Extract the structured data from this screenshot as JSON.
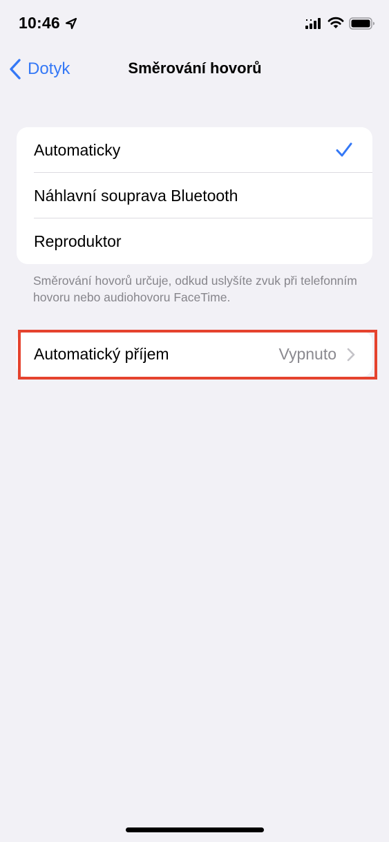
{
  "status_bar": {
    "time": "10:46"
  },
  "nav": {
    "back_label": "Dotyk",
    "title": "Směrování hovorů"
  },
  "routing_options": [
    {
      "label": "Automaticky",
      "selected": true
    },
    {
      "label": "Náhlavní souprava Bluetooth",
      "selected": false
    },
    {
      "label": "Reproduktor",
      "selected": false
    }
  ],
  "footer_note": "Směrování hovorů určuje, odkud uslyšíte zvuk při telefonním hovoru nebo audiohovoru FaceTime.",
  "auto_answer": {
    "label": "Automatický příjem",
    "value": "Vypnuto"
  },
  "colors": {
    "accent": "#3478f6",
    "background": "#f2f1f6",
    "highlight": "#e5432e",
    "secondary_text": "#86858b"
  },
  "icons": [
    "location-arrow-icon",
    "cellular-signal-icon",
    "wifi-icon",
    "battery-icon",
    "back-chevron-icon",
    "checkmark-icon",
    "chevron-right-icon"
  ]
}
